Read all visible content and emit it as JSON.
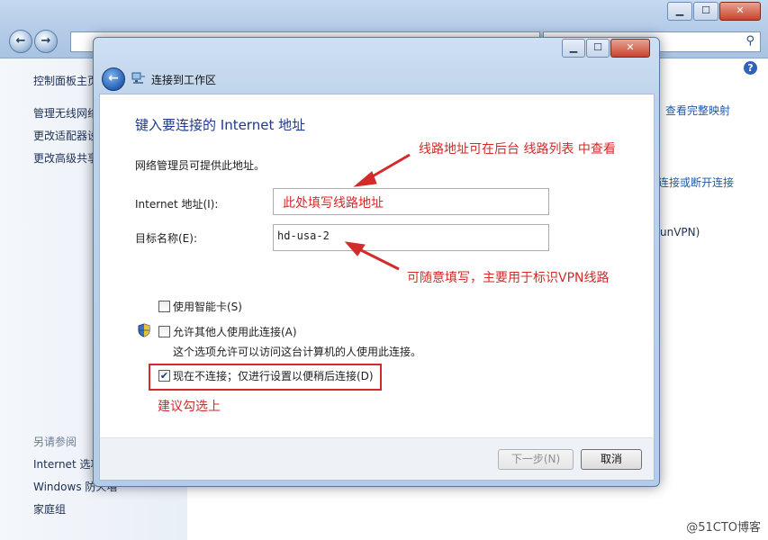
{
  "background": {
    "sidebar_top": [
      "控制面板主页",
      "管理无线网络",
      "更改适配器设置",
      "更改高级共享设置"
    ],
    "see_also_header": "另请参阅",
    "sidebar_bottom": [
      "Internet 选项",
      "Windows 防火墙",
      "家庭组"
    ],
    "right_links": [
      "查看完整映射",
      "连接或断开连接",
      "unVPN)"
    ],
    "help_icon": "?"
  },
  "dialog": {
    "title": "连接到工作区",
    "heading": "键入要连接的 Internet 地址",
    "subtitle": "网络管理员可提供此地址。",
    "internet_address_label": "Internet 地址(I):",
    "internet_address_value": "",
    "destination_name_label": "目标名称(E):",
    "destination_name_value": "hd-usa-2",
    "checkboxes": [
      {
        "label": "使用智能卡(S)",
        "checked": false
      },
      {
        "label": "允许其他人使用此连接(A)",
        "checked": false
      },
      {
        "label": "现在不连接；仅进行设置以便稍后连接(D)",
        "checked": true
      }
    ],
    "allow_others_note": "这个选项允许可以访问这台计算机的人使用此连接。",
    "next_button": "下一步(N)",
    "cancel_button": "取消"
  },
  "annotations": {
    "address_hint": "线路地址可在后台 线路列表 中查看",
    "field_placeholder_note": "此处填写线路地址",
    "name_hint": "可随意填写，主要用于标识VPN线路",
    "check_hint": "建议勾选上",
    "color": "#d32a2a"
  },
  "watermark": "@51CTO博客"
}
